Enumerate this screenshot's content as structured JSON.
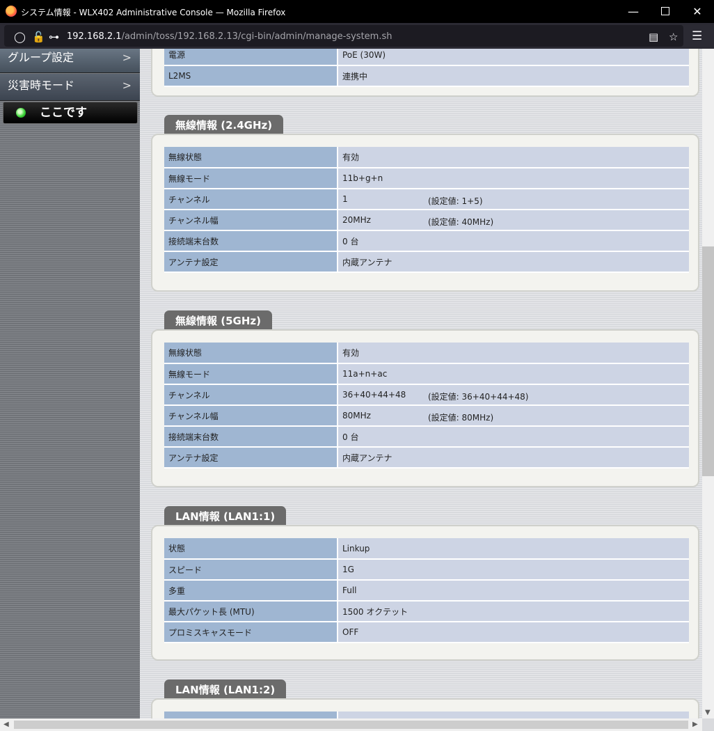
{
  "window": {
    "title": "システム情報 - WLX402 Administrative Console — Mozilla Firefox"
  },
  "browser": {
    "url_host": "192.168.2.1",
    "url_path": "/admin/toss/192.168.2.13/cgi-bin/admin/manage-system.sh"
  },
  "sidebar": {
    "items": [
      {
        "label": "グループ設定",
        "chevron": ">"
      },
      {
        "label": "災害時モード",
        "chevron": ">"
      }
    ],
    "here_label": "ここです"
  },
  "sections": {
    "top": {
      "rows": [
        {
          "key": "電源",
          "value": "PoE (30W)"
        },
        {
          "key": "L2MS",
          "value": "連携中"
        }
      ]
    },
    "wireless24": {
      "title": "無線情報 (2.4GHz)",
      "rows": [
        {
          "key": "無線状態",
          "value": "有効",
          "setting": ""
        },
        {
          "key": "無線モード",
          "value": "11b+g+n",
          "setting": ""
        },
        {
          "key": "チャンネル",
          "value": "1",
          "setting": "(設定値: 1+5)"
        },
        {
          "key": "チャンネル幅",
          "value": "20MHz",
          "setting": "(設定値: 40MHz)"
        },
        {
          "key": "接続端末台数",
          "value": "0 台",
          "setting": ""
        },
        {
          "key": "アンテナ設定",
          "value": "内蔵アンテナ",
          "setting": ""
        }
      ]
    },
    "wireless5": {
      "title": "無線情報 (5GHz)",
      "rows": [
        {
          "key": "無線状態",
          "value": "有効",
          "setting": ""
        },
        {
          "key": "無線モード",
          "value": "11a+n+ac",
          "setting": ""
        },
        {
          "key": "チャンネル",
          "value": "36+40+44+48",
          "setting": "(設定値: 36+40+44+48)"
        },
        {
          "key": "チャンネル幅",
          "value": "80MHz",
          "setting": "(設定値: 80MHz)"
        },
        {
          "key": "接続端末台数",
          "value": "0 台",
          "setting": ""
        },
        {
          "key": "アンテナ設定",
          "value": "内蔵アンテナ",
          "setting": ""
        }
      ]
    },
    "lan1": {
      "title": "LAN情報 (LAN1:1)",
      "rows": [
        {
          "key": "状態",
          "value": "Linkup"
        },
        {
          "key": "スピード",
          "value": "1G"
        },
        {
          "key": "多重",
          "value": "Full"
        },
        {
          "key": "最大パケット長 (MTU)",
          "value": "1500 オクテット"
        },
        {
          "key": "プロミスキャスモード",
          "value": "OFF"
        }
      ]
    },
    "lan2": {
      "title": "LAN情報 (LAN1:2)"
    }
  }
}
